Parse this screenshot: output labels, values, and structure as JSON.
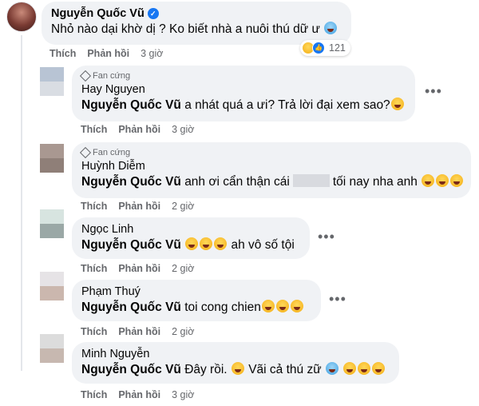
{
  "main_comment": {
    "author": "Nguyễn Quốc Vũ",
    "text": "Nhỏ nào dại khờ dị ? Ko biết nhà a nuôi thú dữ ư",
    "reaction_count": "121",
    "actions": {
      "like": "Thích",
      "reply": "Phản hồi",
      "time": "3 giờ"
    }
  },
  "replies": [
    {
      "badge": "Fan cứng",
      "author": "Hay Nguyen",
      "mention": "Nguyễn Quốc Vũ",
      "text_before": "a nhát quá a ưi? Trả lời đại xem sao?",
      "text_after": "",
      "actions": {
        "like": "Thích",
        "reply": "Phản hồi",
        "time": "3 giờ"
      }
    },
    {
      "badge": "Fan cứng",
      "author": "Huỳnh Diễm",
      "mention": "Nguyễn Quốc Vũ",
      "text_before": "anh ơi cẩn thận cái",
      "text_after": "tối nay nha anh",
      "actions": {
        "like": "Thích",
        "reply": "Phản hồi",
        "time": "2 giờ"
      }
    },
    {
      "badge": "",
      "author": "Ngọc Linh",
      "mention": "Nguyễn Quốc Vũ",
      "text_before": "",
      "text_after": "ah vô số tội",
      "actions": {
        "like": "Thích",
        "reply": "Phản hồi",
        "time": "2 giờ"
      }
    },
    {
      "badge": "",
      "author": "Phạm Thuý",
      "mention": "Nguyễn Quốc Vũ",
      "text_before": "toi cong chien",
      "text_after": "",
      "actions": {
        "like": "Thích",
        "reply": "Phản hồi",
        "time": "2 giờ"
      }
    },
    {
      "badge": "",
      "author": "Minh Nguyễn",
      "mention": "Nguyễn Quốc Vũ",
      "text_before": "Đây rồi.",
      "text_after": "Vãi cả thú zữ",
      "actions": {
        "like": "Thích",
        "reply": "Phản hồi",
        "time": "3 giờ"
      }
    }
  ],
  "icons": {
    "verified": "verified-badge-icon",
    "fan": "diamond-icon",
    "more": "more-options-icon",
    "emoji_laugh": "laughing-emoji-icon",
    "emoji_cold": "cold-face-emoji-icon"
  },
  "colors": {
    "bubble": "#f0f2f5",
    "secondary_text": "#65676b",
    "brand_blue": "#1877f2"
  }
}
